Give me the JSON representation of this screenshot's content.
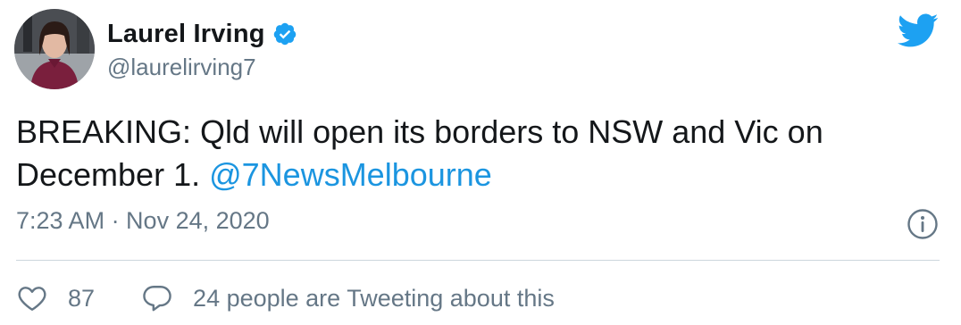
{
  "author": {
    "display_name": "Laurel Irving",
    "handle": "@laurelirving7",
    "verified": true
  },
  "tweet": {
    "text_main": "BREAKING: Qld will open its borders to NSW and Vic on December 1.",
    "mention": "@7NewsMelbourne",
    "timestamp": "7:23 AM · Nov 24, 2020"
  },
  "engagement": {
    "likes": "87",
    "conversation": "24 people are Tweeting about this"
  },
  "colors": {
    "brand_blue": "#1da1f2",
    "link_blue": "#1b95e0",
    "secondary_text": "#657786",
    "divider": "#ccd6dd"
  },
  "icons": {
    "verified": "verified-badge-icon",
    "logo": "twitter-bird-icon",
    "info": "info-icon",
    "like": "heart-icon",
    "reply": "speech-bubble-icon"
  }
}
